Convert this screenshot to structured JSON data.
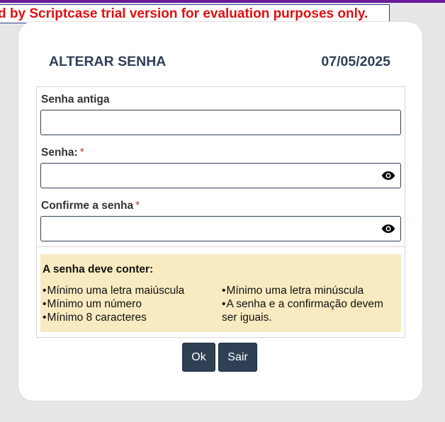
{
  "banner": {
    "text": "d by Scriptcase trial version for evaluation purposes only."
  },
  "colors": {
    "accent_strip": "#6a1b9a",
    "title_color": "#2f4055",
    "banner_text": "#e01010",
    "required_mark": "#c0392b",
    "rules_bg": "#f9ebc1",
    "button_bg": "#2f4055"
  },
  "header": {
    "title": "ALTERAR SENHA",
    "date": "07/05/2025"
  },
  "form": {
    "old_password": {
      "label": "Senha antiga",
      "value": "",
      "placeholder": ""
    },
    "new_password": {
      "label": "Senha:",
      "required_mark": "*",
      "value": "",
      "placeholder": "",
      "toggle_icon": "eye-icon"
    },
    "confirm_password": {
      "label": "Confirme a senha",
      "required_mark": "*",
      "value": "",
      "placeholder": "",
      "toggle_icon": "eye-icon"
    }
  },
  "rules": {
    "title": "A senha deve conter:",
    "left": [
      "Mínimo uma letra maiúscula",
      "Mínimo um número",
      "Mínimo 8 caracteres"
    ],
    "right": [
      "Mínimo uma letra minúscula",
      "A senha e a confirmação devem ser iguais."
    ]
  },
  "buttons": {
    "ok_label": "Ok",
    "exit_label": "Sair"
  }
}
